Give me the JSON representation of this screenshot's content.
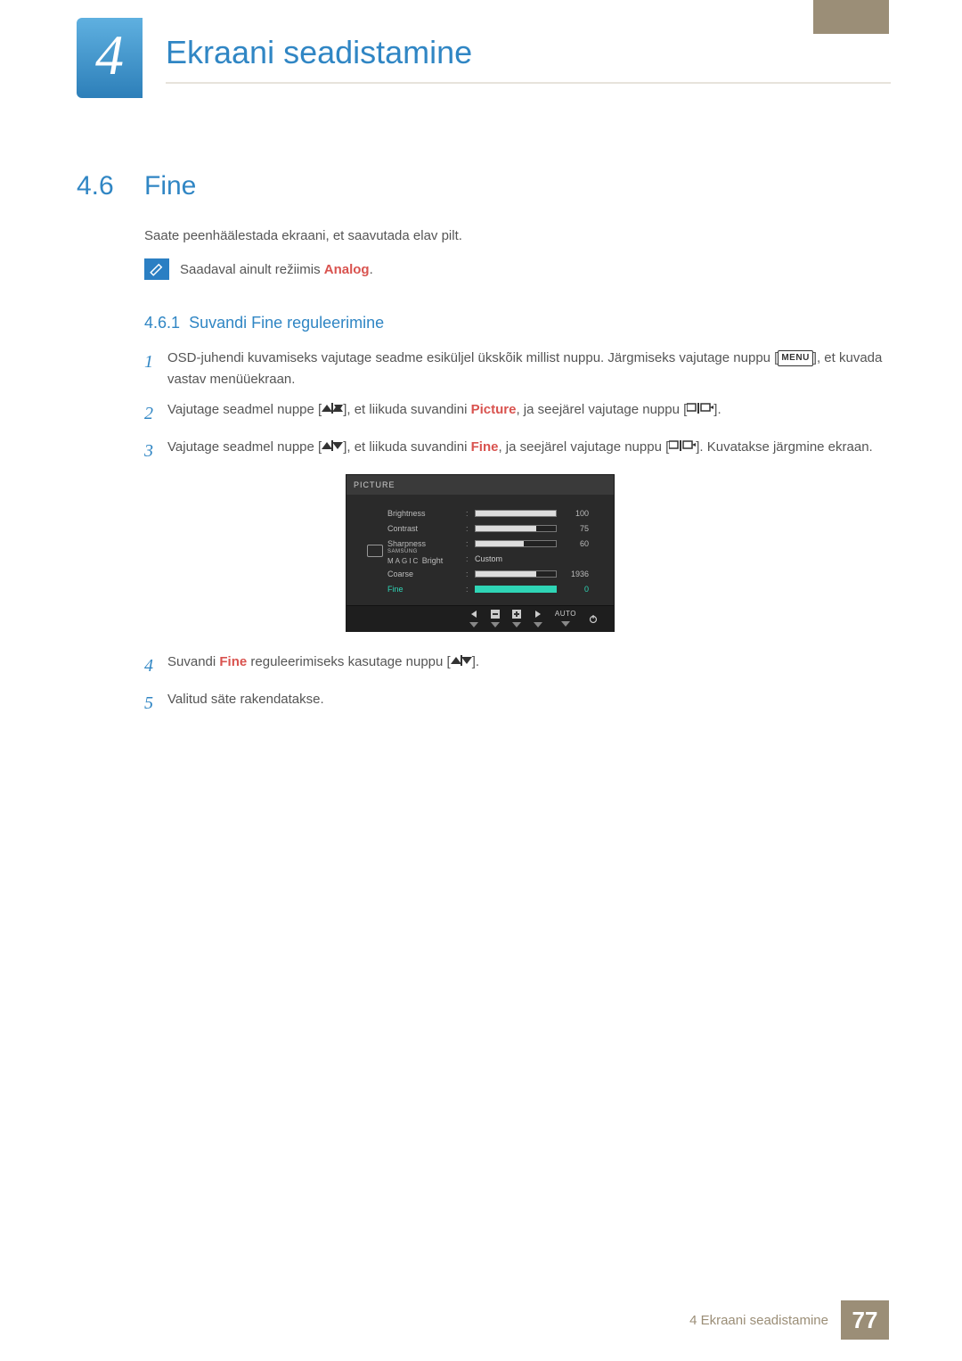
{
  "chapter": {
    "number": "4",
    "title": "Ekraani seadistamine"
  },
  "section": {
    "number": "4.6",
    "title": "Fine"
  },
  "intro": "Saate peenhäälestada ekraani, et saavutada elav pilt.",
  "note": {
    "prefix": "Saadaval ainult režiimis ",
    "kw": "Analog",
    "suffix": "."
  },
  "subsection": {
    "number": "4.6.1",
    "title": "Suvandi Fine reguleerimine"
  },
  "steps": {
    "1": {
      "num": "1",
      "a": "OSD-juhendi kuvamiseks vajutage seadme esiküljel ükskõik millist nuppu. Järgmiseks vajutage nuppu [",
      "menu": "MENU",
      "b": "], et kuvada vastav menüüekraan."
    },
    "2": {
      "num": "2",
      "a": "Vajutage seadmel nuppe [",
      "b": "], et liikuda suvandini ",
      "kw": "Picture",
      "c": ", ja seejärel vajutage nuppu [",
      "d": "]."
    },
    "3": {
      "num": "3",
      "a": "Vajutage seadmel nuppe [",
      "b": "], et liikuda suvandini ",
      "kw": "Fine",
      "c": ", ja seejärel vajutage nuppu [",
      "d": "]. Kuvatakse järgmine ekraan."
    },
    "4": {
      "num": "4",
      "a": "Suvandi ",
      "kw": "Fine",
      "b": " reguleerimiseks kasutage nuppu [",
      "c": "]."
    },
    "5": {
      "num": "5",
      "a": "Valitud säte rakendatakse."
    }
  },
  "osd": {
    "title": "PICTURE",
    "rows": {
      "brightness": {
        "label": "Brightness",
        "value": "100",
        "fill": 100
      },
      "contrast": {
        "label": "Contrast",
        "value": "75",
        "fill": 75
      },
      "sharpness": {
        "label": "Sharpness",
        "value": "60",
        "fill": 60
      },
      "magic": {
        "small": "SAMSUNG",
        "sub": "MAGIC",
        "label2": "Bright",
        "value": "Custom"
      },
      "coarse": {
        "label": "Coarse",
        "value": "1936",
        "fill": 75
      },
      "fine": {
        "label": "Fine",
        "value": "0",
        "fill": 100
      }
    },
    "footer": {
      "auto": "AUTO"
    }
  },
  "footer": {
    "label": "4 Ekraani seadistamine",
    "page": "77"
  }
}
